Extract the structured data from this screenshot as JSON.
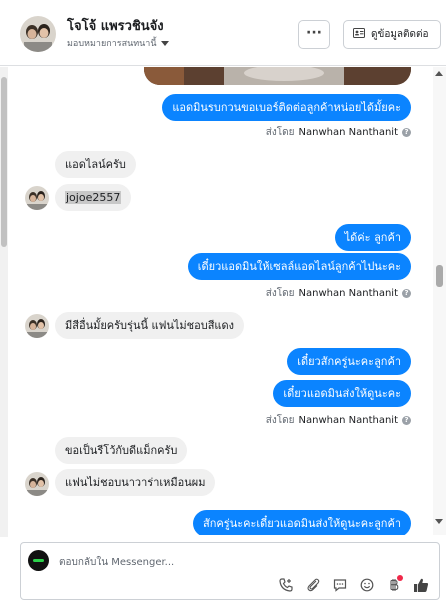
{
  "header": {
    "name": "โจโจ้ แพรวชินจัง",
    "assign_label": "มอบหมายการสนทนานี้",
    "more_label": "···",
    "contact_label": "ดูข้อมูลติดต่อ"
  },
  "messages": {
    "m1": "แอดมินรบกวนขอเบอร์ติดต่อลูกค้าหน่อยได้มั้ยคะ",
    "sent_prefix": "ส่งโดย",
    "sender": "Nanwhan Nanthanit",
    "m2": "แอดไลน์ครับ",
    "m3": "jojoe2557",
    "m4": "ได้ค่ะ ลูกค้า",
    "m5": "เดี๋ยวแอดมินให้เซลล์แอดไลน์ลูกค้าไปนะคะ",
    "m6": "มีสีอื่นมั้ยครับรุ่นนี้ แฟนไม่ชอบสีแดง",
    "m7": "เดี๋ยวสักครู่นะคะลูกค้า",
    "m8": "เดี๋ยวแอดมินส่งให้ดูนะคะ",
    "m9": "ขอเป็นรีโว้กับดีแม็กครับ",
    "m10": "แฟนไม่ชอบนาวาร่าเหมือนผม",
    "m11": "สักครู่นะคะเดี๋ยวแอดมินส่งให้ดูนะคะลูกค้า"
  },
  "composer": {
    "placeholder": "ตอบกลับใน Messenger..."
  },
  "colors": {
    "outgoing": "#0b84ff",
    "incoming": "#f0f0f0"
  }
}
